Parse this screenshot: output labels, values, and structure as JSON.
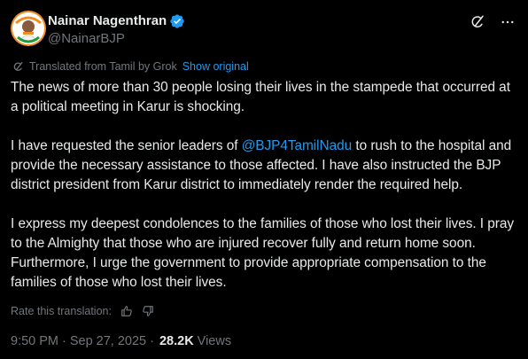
{
  "author": {
    "display_name": "Nainar Nagenthran",
    "handle": "@NainarBJP"
  },
  "icons": {
    "verified": "verified-badge-icon",
    "grok": "grok-icon",
    "more": "more-options-icon",
    "thumbs_up": "thumbs-up-icon",
    "thumbs_down": "thumbs-down-icon"
  },
  "translation": {
    "label": "Translated from Tamil by Grok",
    "show_original": "Show original"
  },
  "post": {
    "paragraph1": "The news of more than 30 people losing their lives in the stampede that occurred at a political meeting in Karur is shocking.",
    "p2_before": "I have requested the senior leaders of ",
    "p2_mention": "@BJP4TamilNadu",
    "p2_after": " to rush to the hospital and provide the necessary assistance to those affected. I have also instructed the BJP district president from Karur district to immediately render the required help.",
    "paragraph3": "I express my deepest condolences to the families of those who lost their lives. I pray to the Almighty that those who are injured recover fully and return home soon. Furthermore, I urge the government to provide appropriate compensation to the families of those who lost their lives."
  },
  "rating": {
    "label": "Rate this translation:"
  },
  "meta": {
    "time": "9:50 PM",
    "separator1": "·",
    "date": "Sep 27, 2025",
    "separator2": "·",
    "views_count": "28.2K",
    "views_label": "Views"
  },
  "colors": {
    "background": "#000000",
    "text": "#e7e9ea",
    "muted": "#71767b",
    "link": "#1d9bf0",
    "verified": "#1d9bf0"
  }
}
